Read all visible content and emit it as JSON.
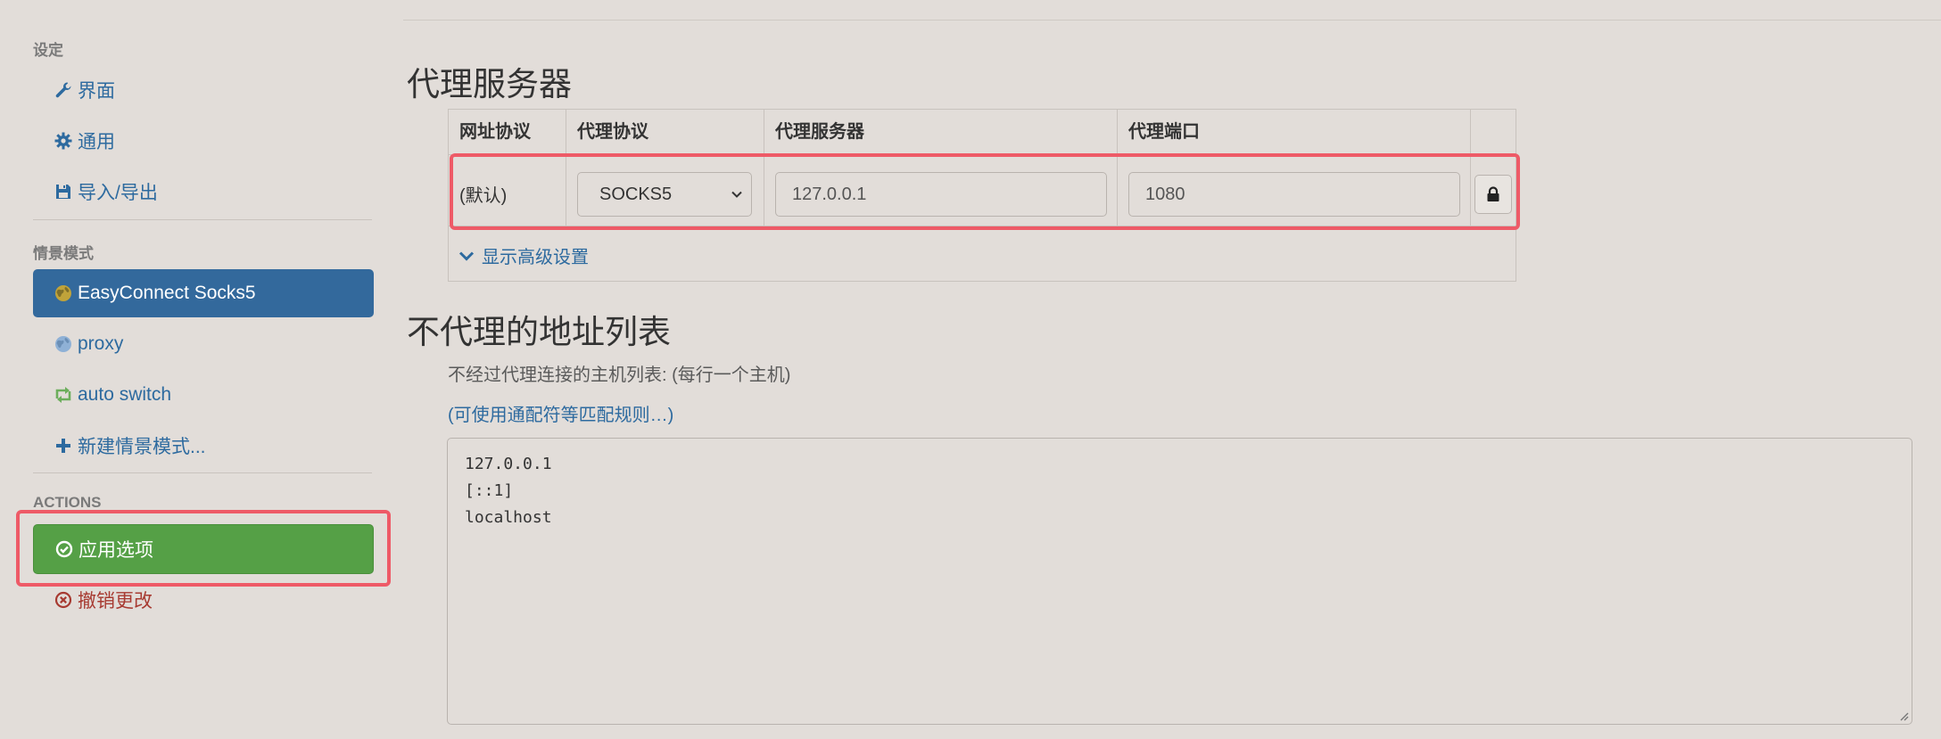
{
  "sidebar": {
    "settings_header": "设定",
    "settings_items": [
      {
        "label": "界面",
        "icon": "wrench-icon"
      },
      {
        "label": "通用",
        "icon": "gear-icon"
      },
      {
        "label": "导入/导出",
        "icon": "floppy-icon"
      }
    ],
    "profiles_header": "情景模式",
    "profiles": [
      {
        "label": "EasyConnect Socks5",
        "icon": "globe-icon",
        "active": true
      },
      {
        "label": "proxy",
        "icon": "globe-icon",
        "active": false
      },
      {
        "label": "auto switch",
        "icon": "retweet-icon",
        "active": false
      },
      {
        "label": "新建情景模式...",
        "icon": "plus-icon",
        "active": false
      }
    ],
    "actions_header": "ACTIONS",
    "apply_label": "应用选项",
    "discard_label": "撤销更改"
  },
  "proxy_section": {
    "title": "代理服务器",
    "columns": [
      "网址协议",
      "代理协议",
      "代理服务器",
      "代理端口"
    ],
    "row": {
      "scheme": "(默认)",
      "protocol": "SOCKS5",
      "server": "127.0.0.1",
      "port": "1080"
    },
    "advanced_link": "显示高级设置"
  },
  "bypass_section": {
    "title": "不代理的地址列表",
    "hint": "不经过代理连接的主机列表: (每行一个主机)",
    "wildcard_link": "(可使用通配符等匹配规则…)",
    "entries": [
      "127.0.0.1",
      "[::1]",
      "localhost"
    ]
  },
  "colors": {
    "background": "#e2ddd9",
    "active_profile": "#33699c",
    "apply_button": "#55a046",
    "link": "#2d6a9f",
    "discard": "#a73a31",
    "highlight": "#ee5a67"
  }
}
